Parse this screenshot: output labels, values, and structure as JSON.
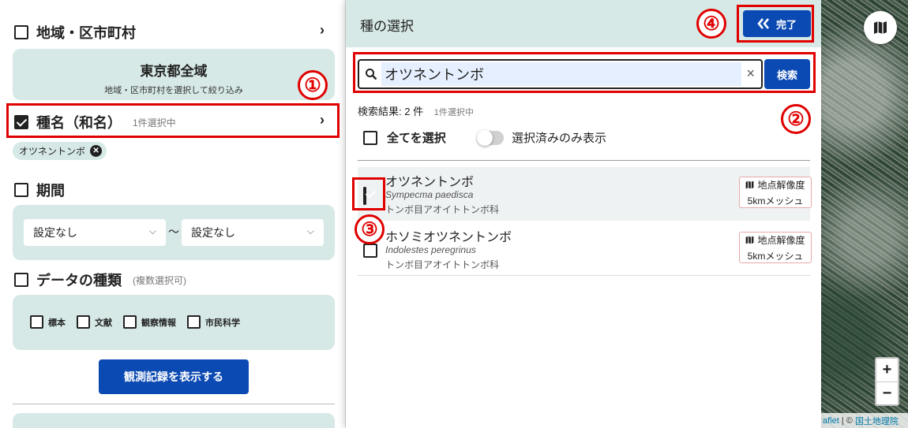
{
  "left": {
    "region": {
      "header": "地域・区市町村",
      "title": "東京都全域",
      "subtitle": "地域・区市町村を選択して絞り込み"
    },
    "species": {
      "header": "種名（和名）",
      "note": "1件選択中",
      "chip": "オツネントンボ"
    },
    "period": {
      "header": "期間",
      "from": "設定なし",
      "to": "設定なし",
      "separator": "～"
    },
    "data_type": {
      "header": "データの種類",
      "note": "(複数選択可)",
      "options": [
        "標本",
        "文献",
        "観察情報",
        "市民科学"
      ]
    },
    "show_button": "観測記録を表示する"
  },
  "drawer": {
    "title": "種の選択",
    "done_label": "完了",
    "search": {
      "value": "オツネントンボ",
      "button": "検索"
    },
    "result_count": "検索結果: 2 件",
    "selected_note": "1件選択中",
    "select_all": "全てを選択",
    "toggle_label": "選択済みのみ表示",
    "items": [
      {
        "name": "オツネントンボ",
        "scientific": "Sympecma paedisca",
        "order": "トンボ目アオイトトンボ科",
        "badge_title": "地点解像度",
        "badge_value": "5kmメッシュ",
        "checked": true
      },
      {
        "name": "ホソミオツネントンボ",
        "scientific": "Indolestes peregrinus",
        "order": "トンボ目アオイトトンボ科",
        "badge_title": "地点解像度",
        "badge_value": "5kmメッシュ",
        "checked": false
      }
    ]
  },
  "map": {
    "zoom_in": "+",
    "zoom_out": "−",
    "attribution_a": "aflet",
    "attribution_sep": " | © ",
    "attribution_b": "国土地理院"
  },
  "annotations": [
    "①",
    "②",
    "③",
    "④"
  ],
  "colors": {
    "accent": "#0c4ab3",
    "card": "#d6e9e6",
    "highlight": "#e00000"
  }
}
